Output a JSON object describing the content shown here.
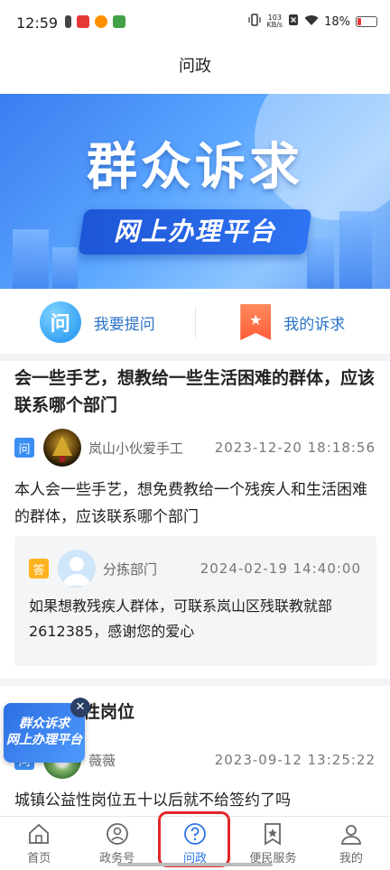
{
  "status_bar": {
    "time": "12:59",
    "net_speed_value": "103",
    "net_speed_unit": "KB/s",
    "battery": "18%"
  },
  "header": {
    "title": "问政"
  },
  "banner": {
    "title": "群众诉求",
    "subtitle": "网上办理平台"
  },
  "actions": {
    "ask_label": "我要提问",
    "ask_icon_text": "问",
    "my_label": "我的诉求"
  },
  "posts": [
    {
      "title": "会一些手艺，想教给一些生活困难的群体，应该联系哪个部门",
      "tag": "问",
      "author": "岚山小伙爱手工",
      "date": "2023-12-20  18:18:56",
      "content": "本人会一些手艺，想免费教给一个残疾人和生活困难的群体，应该联系哪个部门",
      "reply": {
        "tag": "答",
        "author": "分拣部门",
        "date": "2024-02-19  14:40:00",
        "content": "如果想教残疾人群体，可联系岚山区残联教就部2612385，感谢您的爱心"
      }
    },
    {
      "title_visible": "性岗位",
      "tag": "问",
      "author": "薇薇",
      "date": "2023-09-12  13:25:22",
      "content": "城镇公益性岗位五十以后就不给签约了吗"
    }
  ],
  "floating_banner": {
    "line1": "群众诉求",
    "line2": "网上办理平台",
    "close": "✕"
  },
  "tabbar": {
    "items": [
      {
        "label": "首页",
        "icon": "home-icon"
      },
      {
        "label": "政务号",
        "icon": "gov-account-icon"
      },
      {
        "label": "问政",
        "icon": "question-icon",
        "active": true
      },
      {
        "label": "便民服务",
        "icon": "service-star-icon"
      },
      {
        "label": "我的",
        "icon": "user-icon"
      }
    ]
  },
  "colors": {
    "accent": "#2a73e8",
    "link_blue": "#2a73c7",
    "question_tag": "#3a8ff5",
    "answer_tag": "#ffb21f",
    "active_outline": "#e3262a"
  }
}
